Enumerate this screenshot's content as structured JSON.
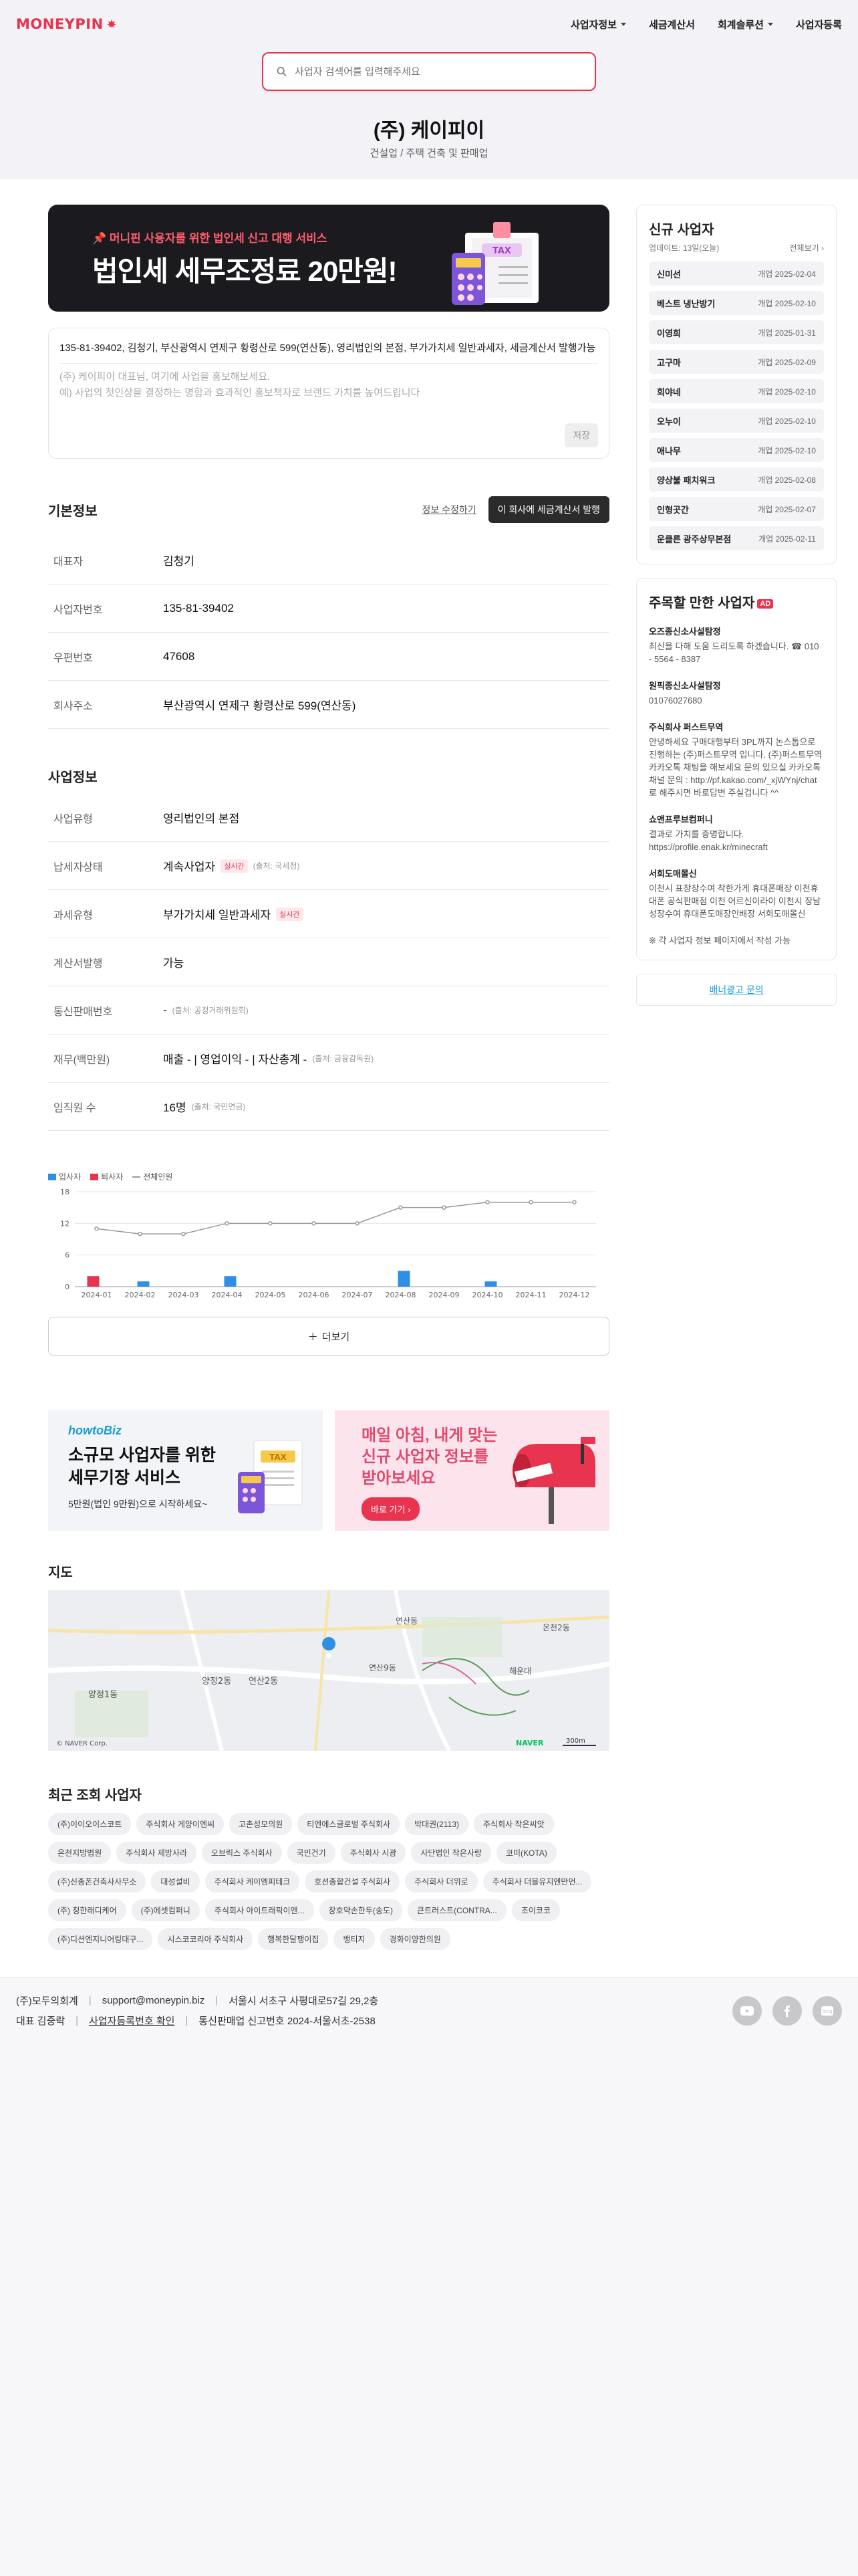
{
  "header": {
    "logo": "MONEYPIN",
    "nav": [
      "사업자정보",
      "세금계산서",
      "회계솔루션",
      "사업자등록"
    ]
  },
  "search": {
    "placeholder": "사업자 검색어를 입력해주세요"
  },
  "company": {
    "name": "(주) 케이피이",
    "category": "건설업 / 주택 건축 및 판매업"
  },
  "banner": {
    "small": "머니핀 사용자를 위한 법인세 신고 대행 서비스",
    "big": "법인세 세무조정료 20만원!"
  },
  "description": {
    "text": "135-81-39402, 김청기, 부산광역시 연제구 황령산로 599(연산동), 영리법인의 본점, 부가가치세 일반과세자, 세금계산서 발행가능",
    "placeholder_line1": "(주) 케이피이 대표님, 여기에 사업을 홍보해보세요.",
    "placeholder_line2": "예) 사업의 첫인상을 결정하는 명함과 효과적인 홍보책자로 브랜드 가치를 높여드립니다",
    "save": "저장"
  },
  "basic": {
    "title": "기본정보",
    "edit_link": "정보 수정하기",
    "issue_button": "이 회사에 세금계산서 발행",
    "rows": [
      {
        "k": "대표자",
        "v": "김청기"
      },
      {
        "k": "사업자번호",
        "v": "135-81-39402"
      },
      {
        "k": "우편번호",
        "v": "47608"
      },
      {
        "k": "회사주소",
        "v": "부산광역시 연제구 황령산로 599(연산동)"
      }
    ]
  },
  "business": {
    "title": "사업정보",
    "type_k": "사업유형",
    "type_v": "영리법인의 본점",
    "tax_k": "납세자상태",
    "tax_v": "계속사업자",
    "vat_k": "과세유형",
    "vat_v": "부가가치세 일반과세자",
    "invoice_k": "계산서발행",
    "invoice_v": "가능",
    "mail_k": "통신판매번호",
    "mail_v": "-",
    "fin_k": "재무(백만원)",
    "fin_v": "매출 - | 영업이익 - | 자산총계 -",
    "emp_k": "임직원 수",
    "emp_v": "16명",
    "realtime": "실시간",
    "src_nts": "(출처: 국세청)",
    "src_ftc": "(출처: 공정거래위원회)",
    "src_fss": "(출처: 금융감독원)",
    "src_nps": "(출처: 국민연금)"
  },
  "chart_data": {
    "type": "bar",
    "categories": [
      "2024-01",
      "2024-02",
      "2024-03",
      "2024-04",
      "2024-05",
      "2024-06",
      "2024-07",
      "2024-08",
      "2024-09",
      "2024-10",
      "2024-11",
      "2024-12"
    ],
    "series": [
      {
        "name": "입사자",
        "type": "bar",
        "color": "#2f8fe5",
        "values": [
          0,
          1,
          0,
          2,
          0,
          0,
          0,
          3,
          0,
          1,
          0,
          0
        ]
      },
      {
        "name": "퇴사자",
        "type": "bar",
        "color": "#e8344e",
        "values": [
          2,
          0,
          0,
          0,
          0,
          0,
          0,
          0,
          0,
          0,
          0,
          0
        ]
      },
      {
        "name": "전체인원",
        "type": "line",
        "color": "#999999",
        "values": [
          11,
          10,
          10,
          12,
          12,
          12,
          12,
          15,
          15,
          16,
          16,
          16
        ]
      }
    ],
    "ylim": [
      0,
      18
    ],
    "yticks": [
      0,
      6,
      12,
      18
    ],
    "legend": "top-left",
    "grid": true
  },
  "more_button": "더보기",
  "promo": {
    "left_brand": "howtoBiz",
    "left_title1": "소규모 사업자를 위한",
    "left_title2": "세무기장 서비스",
    "left_sub": "5만원(법인 9만원)으로 시작하세요~",
    "right_title1": "매일 아침, 내게 맞는",
    "right_title2": "신규 사업자 정보를",
    "right_title3": "받아보세요",
    "right_button": "바로 가기"
  },
  "map": {
    "title": "지도",
    "labels": [
      "연산2동",
      "양정2동",
      "양정1동",
      "연산9동",
      "온천2동",
      "연산동",
      "해운대",
      "NAVER",
      "© NAVER Corp.",
      "300m"
    ]
  },
  "recent": {
    "title": "최근 조회 사업자",
    "chips": [
      "(주)이이오이스코트",
      "주식회사 게양이엔씨",
      "고촌성모의원",
      "티엔에스글로벌 주식회사",
      "박대권(2113)",
      "주식회사 작은씨앗",
      "온천지방법원",
      "주식회사 제방사라",
      "오브릭스 주식회사",
      "국민건기",
      "주식회사 시광",
      "사단법인 작은사랑",
      "코미(KOTA)",
      "(주)신종폰건축사사무소",
      "대성설비",
      "주식회사 케이엠피테크",
      "호선종합건설 주식회사",
      "주식회사 더위로",
      "주식회사 더블유지엔만언...",
      "(주) 청한래디케어",
      "(주)에셋컴퍼니",
      "주식회사 아이트래픽이엔...",
      "장호약손한두(송도)",
      "큰트러스트(CONTRA...",
      "조이코코",
      "(주)디션엔지니어링대구...",
      "시스코코리아 주식회사",
      "행복한달팽이집",
      "뱅티지",
      "경화이양한의원"
    ]
  },
  "new_business": {
    "title": "신규 사업자",
    "updated": "업데이트: 13일(오늘)",
    "view_all": "전체보기",
    "items": [
      {
        "name": "신미선",
        "date": "개업 2025-02-04"
      },
      {
        "name": "베스트 냉난방기",
        "date": "개업 2025-02-10"
      },
      {
        "name": "이영희",
        "date": "개업 2025-01-31"
      },
      {
        "name": "고구마",
        "date": "개업 2025-02-09"
      },
      {
        "name": "회야네",
        "date": "개업 2025-02-10"
      },
      {
        "name": "오누이",
        "date": "개업 2025-02-10"
      },
      {
        "name": "애나무",
        "date": "개업 2025-02-10"
      },
      {
        "name": "양상불 패치워크",
        "date": "개업 2025-02-08"
      },
      {
        "name": "인형곳간",
        "date": "개업 2025-02-07"
      },
      {
        "name": "운클른 광주상무본점",
        "date": "개업 2025-02-11"
      }
    ]
  },
  "notable": {
    "title": "주목할 만한 사업자",
    "badge": "AD",
    "items": [
      {
        "name": "오즈종신소사설탐정",
        "desc": "최신을 다해 도움 드리도록 하겠습니다. ☎ 010 - 5564 - 8387"
      },
      {
        "name": "원픽종신소사설탐정",
        "desc": "01076027680"
      },
      {
        "name": "주식회사 퍼스트무역",
        "desc": "안녕하세요 구매대행부터 3PL까지 논스톱으로 진행하는 (주)퍼스트무역 입니다. (주)퍼스트무역 카카오톡 채팅을 해보세요 문의 있으실 카카오톡 채널 문의 : http://pf.kakao.com/_xjWYnj/chat 로 해주시면 바로답변 주실겁니다 ^^"
      },
      {
        "name": "쇼앤프루브컴퍼니",
        "desc": "결과로 가치를 증명합니다. https://profile.enak.kr/minecraft"
      },
      {
        "name": "서희도매몰신",
        "desc": "이천시 표창장수여 착한가게 휴대폰매장 이천휴대폰 공식판매점 이천 어르신이라이 이천시 장남성장수여 휴대폰도매장인배장 서희도매몰신"
      }
    ],
    "note": "※ 각 사업자 정보 페이지에서 작성 가능",
    "ad_link": "배너광고 문의"
  },
  "footer": {
    "company": "(주)모두의회계",
    "email": "support@moneypin.biz",
    "address": "서울시 서초구 사평대로57길 29,2층",
    "ceo": "대표 김중락",
    "biz_link": "사업자등록번호 확인",
    "telecom": "통신판매업 신고번호 2024-서울서초-2538"
  }
}
